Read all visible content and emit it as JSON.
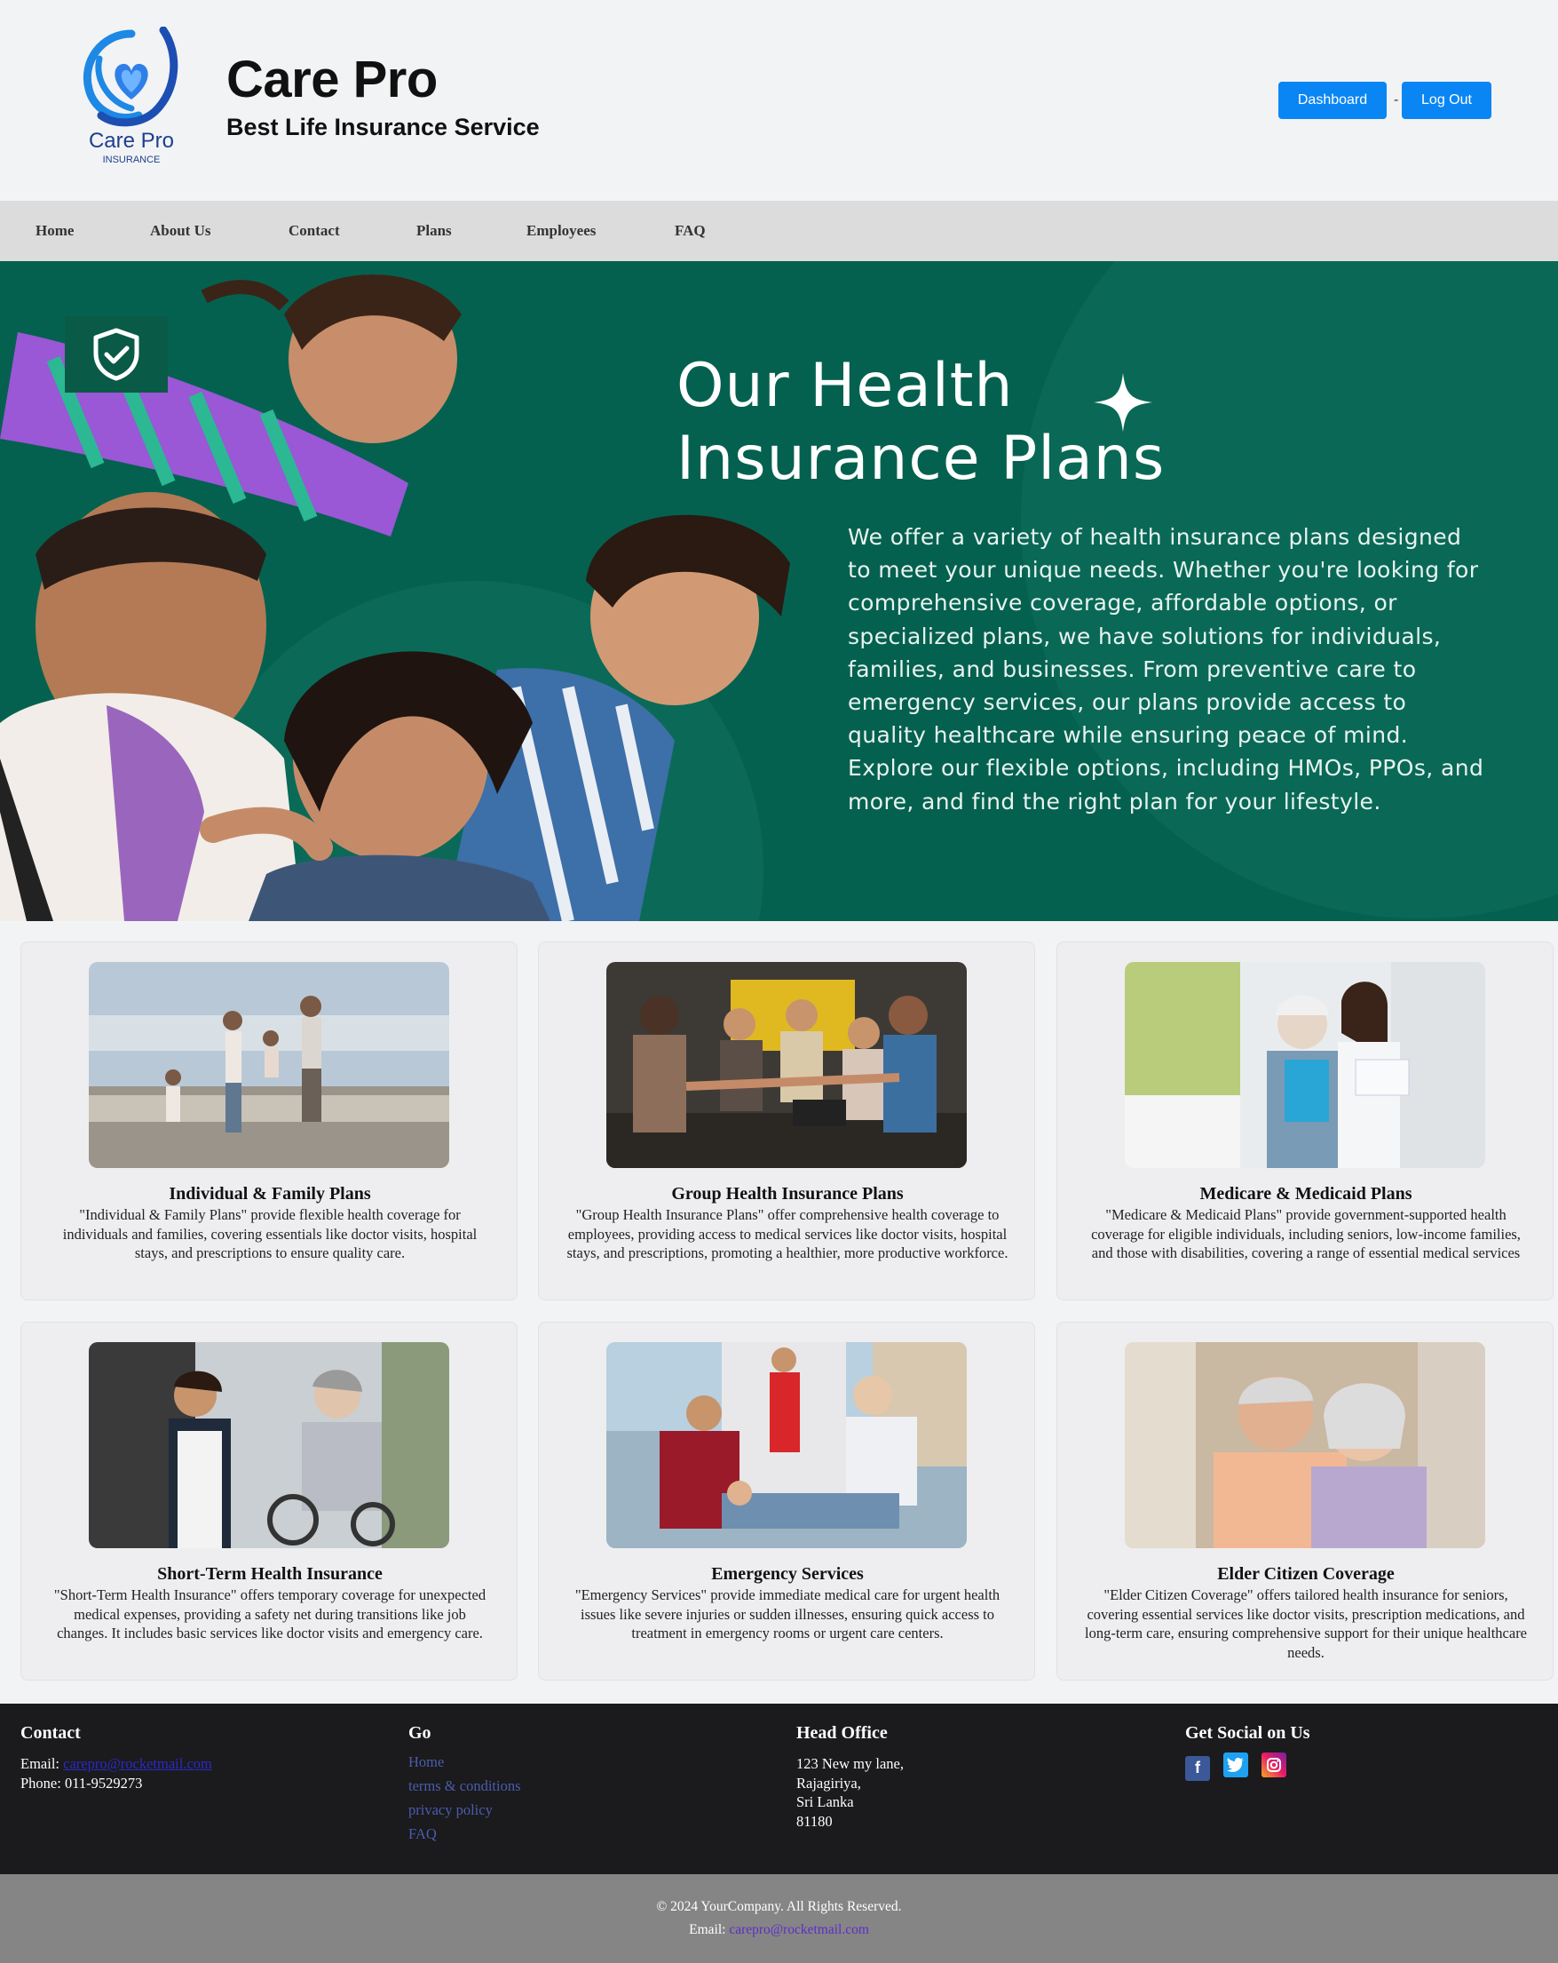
{
  "header": {
    "logo_name": "Care Pro",
    "logo_sub": "INSURANCE",
    "title": "Care Pro",
    "subtitle": "Best Life Insurance Service",
    "dashboard_label": "Dashboard",
    "separator": "-",
    "logout_label": "Log Out"
  },
  "nav": {
    "items": [
      "Home",
      "About Us",
      "Contact",
      "Plans",
      "Employees",
      "FAQ"
    ]
  },
  "hero": {
    "title_line1": "Our Health",
    "title_line2": "Insurance Plans",
    "text": "We offer a variety of health insurance plans designed to meet your unique needs. Whether you're looking for comprehensive coverage, affordable options, or specialized plans, we have solutions for individuals, families, and businesses. From preventive care to emergency services, our plans provide access to quality healthcare while ensuring peace of mind. Explore our flexible options, including HMOs, PPOs, and more, and find the right plan for your lifestyle."
  },
  "cards": [
    {
      "title": "Individual & Family Plans",
      "desc": "\"Individual & Family Plans\" provide flexible health coverage for individuals and families, covering essentials like doctor visits, hospital stays, and prescriptions to ensure quality care."
    },
    {
      "title": "Group Health Insurance Plans",
      "desc": "\"Group Health Insurance Plans\" offer comprehensive health coverage to employees, providing access to medical services like doctor visits, hospital stays, and prescriptions, promoting a healthier, more productive workforce."
    },
    {
      "title": "Medicare & Medicaid Plans",
      "desc": "\"Medicare & Medicaid Plans\" provide government-supported health coverage for eligible individuals, including seniors, low-income families, and those with disabilities, covering a range of essential medical services"
    },
    {
      "title": "Short-Term Health Insurance",
      "desc": "\"Short-Term Health Insurance\" offers temporary coverage for unexpected medical expenses, providing a safety net during transitions like job changes. It includes basic services like doctor visits and emergency care."
    },
    {
      "title": "Emergency Services",
      "desc": "\"Emergency Services\" provide immediate medical care for urgent health issues like severe injuries or sudden illnesses, ensuring quick access to treatment in emergency rooms or urgent care centers."
    },
    {
      "title": "Elder Citizen Coverage",
      "desc": "\"Elder Citizen Coverage\" offers tailored health insurance for seniors, covering essential services like doctor visits, prescription medications, and long-term care, ensuring comprehensive support for their unique healthcare needs."
    }
  ],
  "footer": {
    "contact": {
      "heading": "Contact",
      "email_label": "Email:",
      "email": "carepro@rocketmail.com",
      "phone": "Phone: 011-9529273"
    },
    "go": {
      "heading": "Go",
      "links": [
        "Home",
        "terms & conditions",
        "privacy policy",
        "FAQ"
      ]
    },
    "office": {
      "heading": "Head Office",
      "lines": [
        "123 New my lane,",
        "Rajagiriya,",
        "Sri Lanka",
        "81180"
      ]
    },
    "social": {
      "heading": "Get Social on Us",
      "icons": [
        "facebook-icon",
        "twitter-icon",
        "instagram-icon"
      ]
    }
  },
  "copyright": {
    "line": "© 2024 YourCompany. All Rights Reserved.",
    "email_label": "Email:",
    "email": "carepro@rocketmail.com"
  },
  "colors": {
    "accent_button": "#0a86f4",
    "hero_bg": "#05614f",
    "footer_bg": "#1b1a1c",
    "copyright_bg": "#858586"
  }
}
